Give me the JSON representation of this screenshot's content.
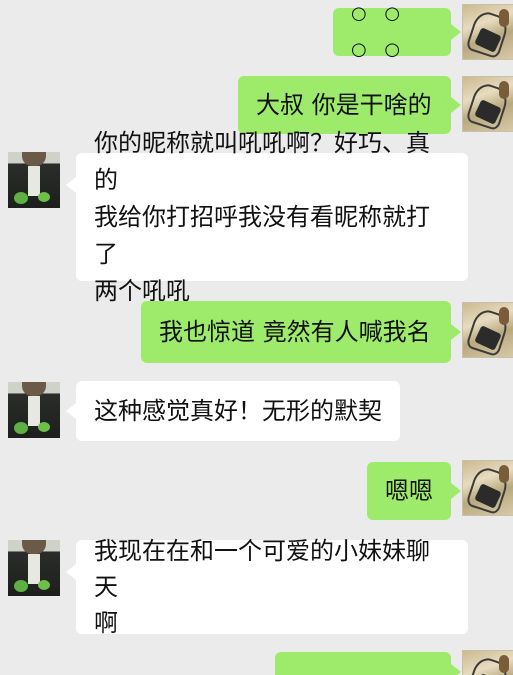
{
  "messages": [
    {
      "side": "out",
      "text": "○ ○ ○ ○"
    },
    {
      "side": "out",
      "text": "大叔 你是干啥的"
    },
    {
      "side": "in",
      "lines": [
        "你的昵称就叫吼吼啊？好巧、真的",
        "我给你打招呼我没有看昵称就打了",
        "两个吼吼"
      ]
    },
    {
      "side": "out",
      "text": "我也惊道 竟然有人喊我名"
    },
    {
      "side": "in",
      "lines": [
        "这种感觉真好！无形的默契"
      ]
    },
    {
      "side": "out",
      "text": "嗯嗯"
    },
    {
      "side": "in",
      "lines": [
        "我现在在和一个可爱的小妹妹聊天",
        "啊"
      ]
    },
    {
      "side": "out",
      "text": ""
    }
  ],
  "colors": {
    "background": "#ebebeb",
    "outgoing_bubble": "#9eea6a",
    "incoming_bubble": "#ffffff"
  },
  "icons": {
    "self_avatar": "sketch-figure-avatar",
    "other_avatar": "dark-jacket-avatar"
  }
}
